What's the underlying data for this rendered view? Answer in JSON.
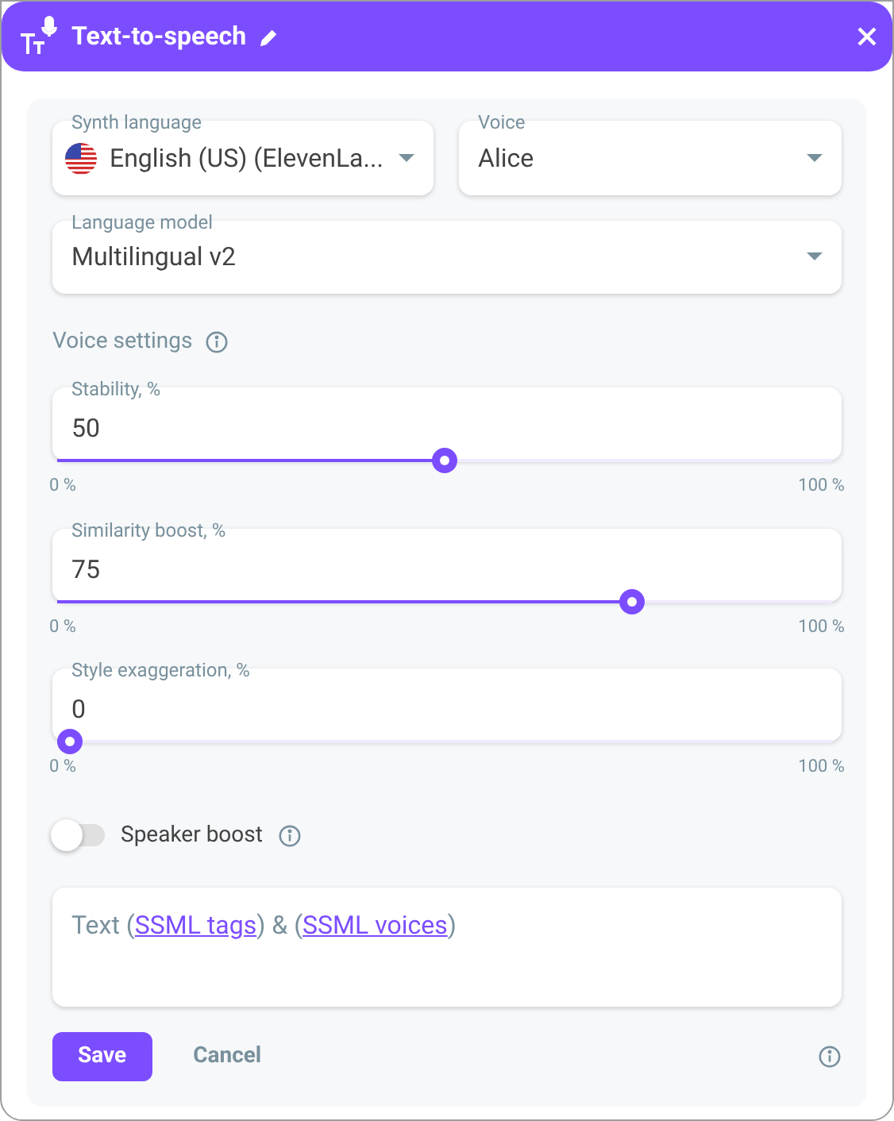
{
  "window": {
    "title": "Text-to-speech"
  },
  "selects": [
    {
      "label": "Synth language",
      "value": "English (US) (ElevenLa...",
      "flag": true
    },
    {
      "label": "Voice",
      "value": "Alice",
      "flag": false
    }
  ],
  "language_model": {
    "label": "Language model",
    "value": "Multilingual v2"
  },
  "voice_settings": {
    "title": "Voice settings"
  },
  "sliders": [
    {
      "label": "Stability, %",
      "value": "50",
      "level": 0.5,
      "min": "0 %",
      "max": "100 %"
    },
    {
      "label": "Similarity boost, %",
      "value": "75",
      "level": 0.75,
      "min": "0 %",
      "max": "100 %"
    },
    {
      "label": "Style exaggeration, %",
      "value": "0",
      "level": 0,
      "min": "0 %",
      "max": "100 %"
    }
  ],
  "speaker_boost": {
    "label": "Speaker boost",
    "on": false
  },
  "text_field": {
    "parts": [
      {
        "kind": "text",
        "text": "Text ("
      },
      {
        "kind": "link",
        "text": "SSML tags"
      },
      {
        "kind": "text",
        "text": ") & ("
      },
      {
        "kind": "link",
        "text": "SSML voices"
      },
      {
        "kind": "text",
        "text": ")"
      }
    ]
  },
  "buttons": [
    {
      "kind": "primary",
      "label": "Save"
    },
    {
      "kind": "plain",
      "label": "Cancel"
    }
  ]
}
